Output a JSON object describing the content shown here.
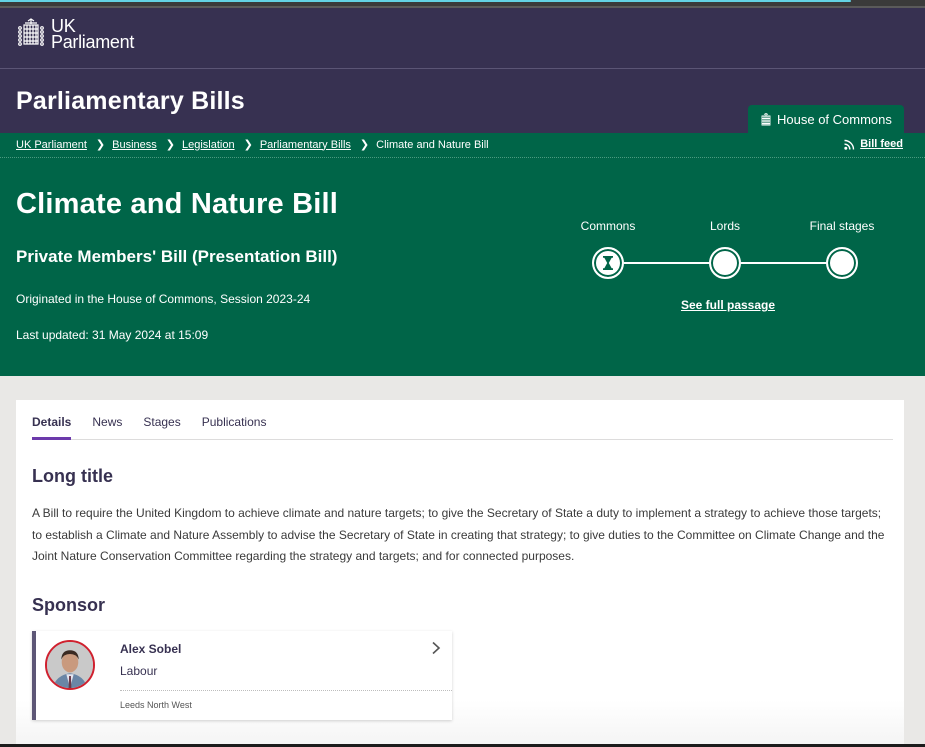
{
  "browser": {
    "load_progress": 0.92
  },
  "masthead": {
    "logo_line1": "UK",
    "logo_line2": "Parliament"
  },
  "section": {
    "title": "Parliamentary Bills",
    "house_tab": "House of Commons"
  },
  "breadcrumb": {
    "items": [
      "UK Parliament",
      "Business",
      "Legislation",
      "Parliamentary Bills"
    ],
    "current": "Climate and Nature Bill"
  },
  "bill_feed": "Bill feed",
  "bill": {
    "title": "Climate and Nature Bill",
    "type": "Private Members' Bill (Presentation Bill)",
    "origin": "Originated in the House of Commons, Session 2023-24",
    "updated": "Last updated: 31 May 2024 at 15:09"
  },
  "stages": {
    "items": [
      {
        "label": "Commons",
        "status": "in-progress",
        "icon": "hourglass-icon"
      },
      {
        "label": "Lords",
        "status": "not-started"
      },
      {
        "label": "Final stages",
        "status": "not-started"
      }
    ],
    "full_passage": "See full passage"
  },
  "tabs": [
    {
      "label": "Details",
      "active": true
    },
    {
      "label": "News",
      "active": false
    },
    {
      "label": "Stages",
      "active": false
    },
    {
      "label": "Publications",
      "active": false
    }
  ],
  "details": {
    "long_title_heading": "Long title",
    "long_title": "A Bill to require the United Kingdom to achieve climate and nature targets; to give the Secretary of State a duty to implement a strategy to achieve those targets; to establish a Climate and Nature Assembly to advise the Secretary of State in creating that strategy; to give duties to the Committee on Climate Change and the Joint Nature Conservation Committee regarding the strategy and targets; and for connected purposes.",
    "sponsor_heading": "Sponsor",
    "sponsor": {
      "name": "Alex Sobel",
      "party": "Labour",
      "constituency": "Leeds North West",
      "party_color": "#d0202e"
    }
  },
  "colors": {
    "purple": "#373151",
    "green": "#006548",
    "tab_accent": "#6c3aab",
    "page_bg": "#e9e8e6"
  }
}
